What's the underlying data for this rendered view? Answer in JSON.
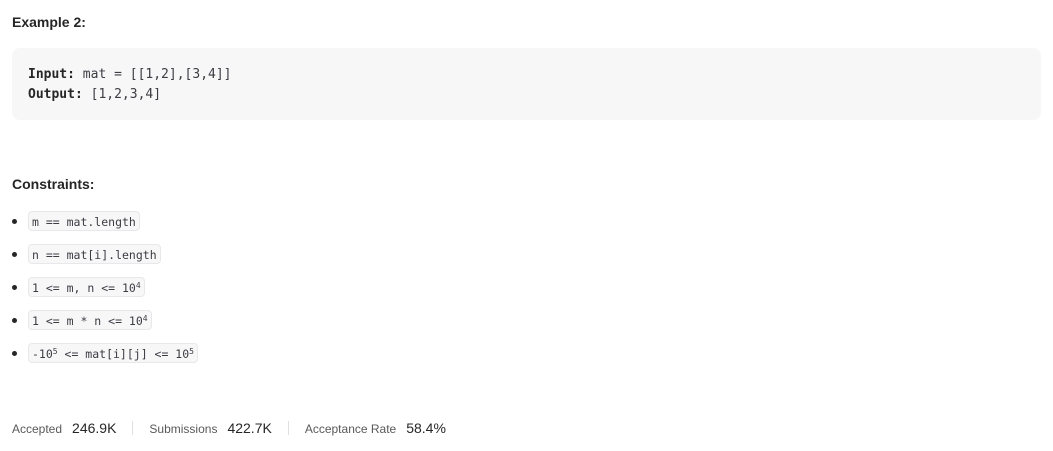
{
  "example": {
    "title": "Example 2:",
    "input_label": "Input:",
    "input_value": " mat = [[1,2],[3,4]]",
    "output_label": "Output:",
    "output_value": " [1,2,3,4]"
  },
  "constraints": {
    "title": "Constraints:",
    "items": [
      {
        "text": "m == mat.length"
      },
      {
        "text": "n == mat[i].length"
      },
      {
        "text": "1 <= m, n <= 10",
        "sup": "4"
      },
      {
        "text": "1 <= m * n <= 10",
        "sup": "4"
      },
      {
        "pre": "-10",
        "pre_sup": "5",
        "text": " <= mat[i][j] <= 10",
        "sup": "5"
      }
    ]
  },
  "stats": {
    "accepted_label": "Accepted",
    "accepted_value": "246.9K",
    "submissions_label": "Submissions",
    "submissions_value": "422.7K",
    "acceptance_rate_label": "Acceptance Rate",
    "acceptance_rate_value": "58.4%"
  }
}
